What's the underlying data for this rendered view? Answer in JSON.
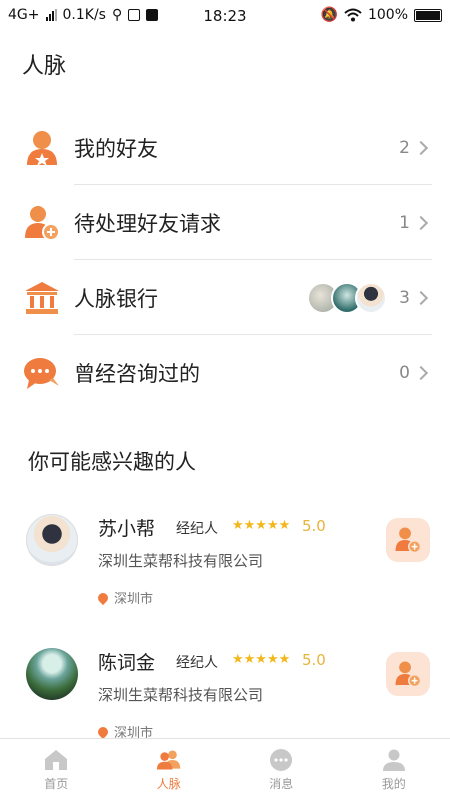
{
  "status_bar": {
    "network": "4G+",
    "speed": "0.1K/s",
    "time": "18:23",
    "battery": "100%"
  },
  "page": {
    "title": "人脉"
  },
  "menu": [
    {
      "label": "我的好友",
      "count": "2",
      "icon": "friend-icon"
    },
    {
      "label": "待处理好友请求",
      "count": "1",
      "icon": "add-friend-icon"
    },
    {
      "label": "人脉银行",
      "count": "3",
      "icon": "bank-icon"
    },
    {
      "label": "曾经咨询过的",
      "count": "0",
      "icon": "chat-icon"
    }
  ],
  "suggestions": {
    "title": "你可能感兴趣的人",
    "people": [
      {
        "name": "苏小帮",
        "role": "经纪人",
        "stars": 5,
        "rating": "5.0",
        "company": "深圳生菜帮科技有限公司",
        "city": "深圳市"
      },
      {
        "name": "陈词金",
        "role": "经纪人",
        "stars": 5,
        "rating": "5.0",
        "company": "深圳生菜帮科技有限公司",
        "city": "深圳市"
      }
    ]
  },
  "bottom_nav": [
    {
      "label": "首页",
      "icon": "home-icon",
      "active": false
    },
    {
      "label": "人脉",
      "icon": "contacts-icon",
      "active": true
    },
    {
      "label": "消息",
      "icon": "message-icon",
      "active": false
    },
    {
      "label": "我的",
      "icon": "profile-icon",
      "active": false
    }
  ],
  "colors": {
    "accent": "#ef7b3e",
    "star": "#f2b71a"
  }
}
